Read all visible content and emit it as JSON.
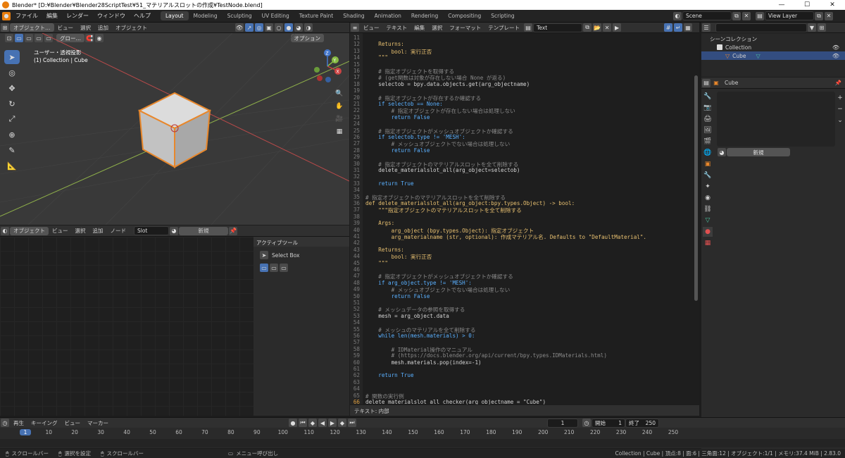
{
  "window": {
    "title": "Blender* [D:¥Blender¥Blender28ScriptTest¥51_マテリアルスロットの作成¥TestNode.blend]",
    "controls": [
      "—",
      "☐",
      "✕"
    ]
  },
  "menu": [
    "ファイル",
    "編集",
    "レンダー",
    "ウィンドウ",
    "ヘルプ"
  ],
  "workspaces": [
    "Layout",
    "Modeling",
    "Sculpting",
    "UV Editing",
    "Texture Paint",
    "Shading",
    "Animation",
    "Rendering",
    "Compositing",
    "Scripting"
  ],
  "active_workspace": "Layout",
  "scene": {
    "name": "Scene",
    "view_layer": "View Layer"
  },
  "viewport": {
    "mode": "オブジェクト…",
    "menus": [
      "ビュー",
      "選択",
      "追加",
      "オブジェクト"
    ],
    "orient": "グロー…",
    "options": "オプション",
    "title": "ユーザー・透視投影",
    "subtitle": "(1) Collection | Cube",
    "axes": [
      "X",
      "Y",
      "Z"
    ]
  },
  "node_editor": {
    "mode": "オブジェクト",
    "menus": [
      "ビュー",
      "選択",
      "追加",
      "ノード"
    ],
    "slot": "Slot",
    "new_label": "新規",
    "active_tool": "アクティブツール",
    "select_box": "Select Box"
  },
  "text_editor": {
    "menus": [
      "ビュー",
      "テキスト",
      "編集",
      "選択",
      "フォーマット",
      "テンプレート"
    ],
    "text_name": "Text",
    "footer": "テキスト: 内部",
    "lines": [
      {
        "n": "11",
        "t": ""
      },
      {
        "n": "12",
        "t": "    Returns:"
      },
      {
        "n": "13",
        "t": "        bool: 実行正否"
      },
      {
        "n": "14",
        "t": "    \"\"\""
      },
      {
        "n": "15",
        "t": ""
      },
      {
        "n": "16",
        "t": "    # 指定オブジェクトを取得する"
      },
      {
        "n": "17",
        "t": "    # (get関数は対象が存在しない場合 None が返る)"
      },
      {
        "n": "18",
        "t": "    selectob = bpy.data.objects.get(arg_objectname)"
      },
      {
        "n": "19",
        "t": ""
      },
      {
        "n": "20",
        "t": "    # 指定オブジェクトが存在するか確認する"
      },
      {
        "n": "21",
        "t": "    if selectob == None:"
      },
      {
        "n": "22",
        "t": "        # 指定オブジェクトが存在しない場合は処理しない"
      },
      {
        "n": "23",
        "t": "        return False"
      },
      {
        "n": "24",
        "t": ""
      },
      {
        "n": "25",
        "t": "    # 指定オブジェクトがメッシュオブジェクトか確認する"
      },
      {
        "n": "26",
        "t": "    if selectob.type != 'MESH':"
      },
      {
        "n": "27",
        "t": "        # メッシュオブジェクトでない場合は処理しない"
      },
      {
        "n": "28",
        "t": "        return False"
      },
      {
        "n": "29",
        "t": ""
      },
      {
        "n": "30",
        "t": "    # 指定オブジェクトのマテリアルスロットを全て削除する"
      },
      {
        "n": "31",
        "t": "    delete_materialslot_all(arg_object=selectob)"
      },
      {
        "n": "32",
        "t": ""
      },
      {
        "n": "33",
        "t": "    return True"
      },
      {
        "n": "34",
        "t": ""
      },
      {
        "n": "35",
        "t": "# 指定オブジェクトのマテリアルスロットを全て削除する"
      },
      {
        "n": "36",
        "t": "def delete_materialslot_all(arg_object:bpy.types.Object) -> bool:"
      },
      {
        "n": "37",
        "t": "    \"\"\"指定オブジェクトのマテリアルスロットを全て削除する"
      },
      {
        "n": "38",
        "t": ""
      },
      {
        "n": "39",
        "t": "    Args:"
      },
      {
        "n": "40",
        "t": "        arg_object (bpy.types.Object): 指定オブジェクト"
      },
      {
        "n": "41",
        "t": "        arg_materialname (str, optional): 作成マテリアル名. Defaults to \"DefaultMaterial\"."
      },
      {
        "n": "42",
        "t": ""
      },
      {
        "n": "43",
        "t": "    Returns:"
      },
      {
        "n": "44",
        "t": "        bool: 実行正否"
      },
      {
        "n": "45",
        "t": "    \"\"\""
      },
      {
        "n": "46",
        "t": ""
      },
      {
        "n": "47",
        "t": "    # 指定オブジェクトがメッシュオブジェクトか確認する"
      },
      {
        "n": "48",
        "t": "    if arg_object.type != 'MESH':"
      },
      {
        "n": "49",
        "t": "        # メッシュオブジェクトでない場合は処理しない"
      },
      {
        "n": "50",
        "t": "        return False"
      },
      {
        "n": "51",
        "t": ""
      },
      {
        "n": "52",
        "t": "    # メッシュデータの参照を取得する"
      },
      {
        "n": "53",
        "t": "    mesh = arg_object.data"
      },
      {
        "n": "54",
        "t": ""
      },
      {
        "n": "55",
        "t": "    # メッシュのマテリアルを全て削除する"
      },
      {
        "n": "56",
        "t": "    while len(mesh.materials) > 0:"
      },
      {
        "n": "57",
        "t": ""
      },
      {
        "n": "58",
        "t": "        # IDMaterial操作のマニュアル"
      },
      {
        "n": "59",
        "t": "        # (https://docs.blender.org/api/current/bpy.types.IDMaterials.html)"
      },
      {
        "n": "60",
        "t": "        mesh.materials.pop(index=-1)"
      },
      {
        "n": "61",
        "t": ""
      },
      {
        "n": "62",
        "t": "    return True"
      },
      {
        "n": "63",
        "t": ""
      },
      {
        "n": "64",
        "t": ""
      },
      {
        "n": "65",
        "t": "# 関数の実行例"
      },
      {
        "n": "66",
        "t": "delete_materialslot_all_checker(arg_objectname = \"Cube\")"
      }
    ]
  },
  "outliner": {
    "root": "シーンコレクション",
    "collection": "Collection",
    "object": "Cube"
  },
  "properties": {
    "object": "Cube",
    "new_label": "新規"
  },
  "timeline": {
    "menus": [
      "再生",
      "キーイング",
      "ビュー",
      "マーカー"
    ],
    "current": "1",
    "start_label": "開始",
    "start": "1",
    "end_label": "終了",
    "end": "250",
    "ticks": [
      "1",
      "10",
      "20",
      "30",
      "40",
      "50",
      "60",
      "70",
      "80",
      "90",
      "100",
      "110",
      "120",
      "130",
      "140",
      "150",
      "160",
      "170",
      "180",
      "190",
      "200",
      "210",
      "220",
      "230",
      "240",
      "250"
    ]
  },
  "status": {
    "left": [
      "スクロールバー",
      "選択を設定",
      "スクロールバー",
      "メニュー呼び出し"
    ],
    "right": "Collection | Cube | 頂点:8 | 面:6 | 三角面:12 | オブジェクト:1/1 | メモリ:37.4 MiB | 2.83.0"
  }
}
